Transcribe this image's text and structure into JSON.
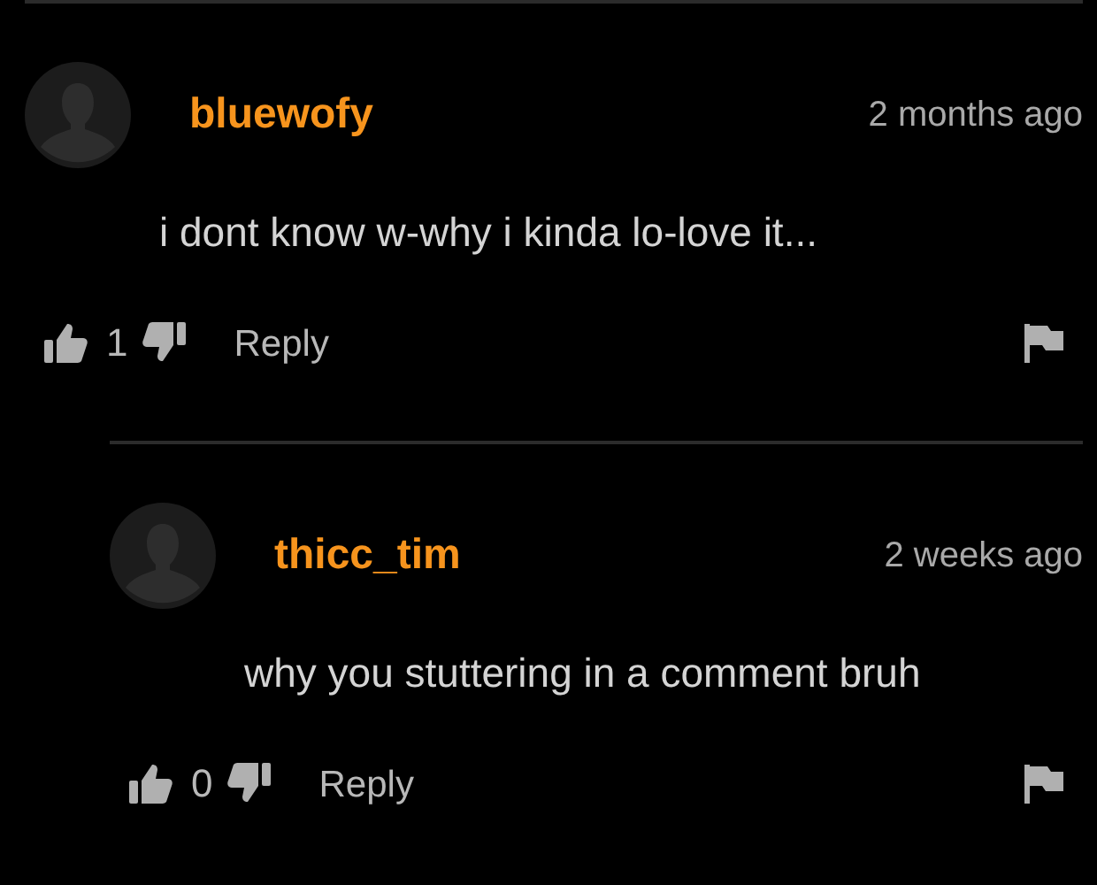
{
  "comments": [
    {
      "username": "bluewofy",
      "time": "2 months ago",
      "text": "i dont know w-why i kinda lo-love it...",
      "likes": "1",
      "reply_label": "Reply",
      "children": [
        {
          "username": "thicc_tim",
          "time": "2 weeks ago",
          "text": "why you stuttering in a comment bruh",
          "likes": "0",
          "reply_label": "Reply"
        }
      ]
    }
  ]
}
